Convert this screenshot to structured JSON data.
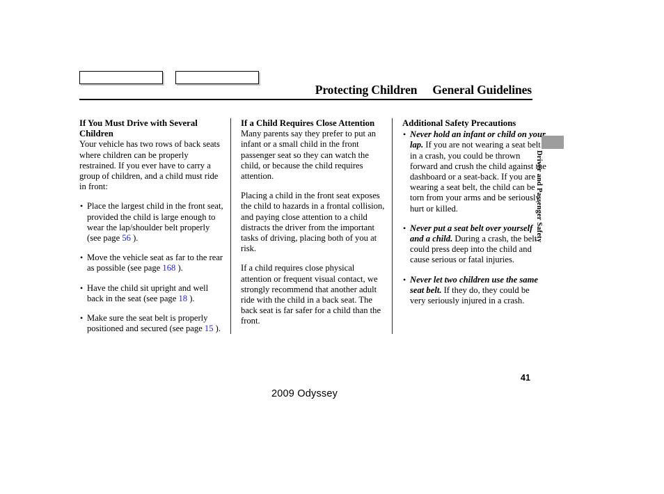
{
  "header": {
    "box1_label": "",
    "box2_label": "",
    "title_left": "Protecting Children",
    "title_right": "General Guidelines"
  },
  "side_tab": {
    "label": "Driver and Passenger Safety"
  },
  "footer": {
    "page_number": "41",
    "model": "2009  Odyssey"
  },
  "columns": {
    "col1": {
      "heading": "If You Must Drive with Several Children",
      "intro": "Your vehicle has two rows of back seats where children can be properly restrained. If you ever have to carry a group of children, and a child must ride in front:",
      "bullets": [
        {
          "text_before": "Place the largest child in the front seat, provided the child is large enough to wear the lap/shoulder belt properly (see page ",
          "page_ref": "56",
          "text_after": " )."
        },
        {
          "text_before": "Move the vehicle seat as far to the rear as possible (see page ",
          "page_ref": "168",
          "text_after": " )."
        },
        {
          "text_before": "Have the child sit upright and well back in the seat (see page ",
          "page_ref": "18",
          "text_after": " )."
        },
        {
          "text_before": "Make sure the seat belt is properly positioned and secured (see page ",
          "page_ref": "15",
          "text_after": " )."
        }
      ],
      "bullet_glyph": "•"
    },
    "col2": {
      "heading": "If a Child Requires Close Attention",
      "para1": "Many parents say they prefer to put an infant or a small child in the front passenger seat so they can watch the child, or because the child requires attention.",
      "para2": "Placing a child in the front seat exposes the child to hazards in a frontal collision, and paying close attention to a child distracts the driver from the important tasks of driving, placing both of you at risk.",
      "para3": "If a child requires close physical attention or frequent visual contact, we strongly recommend that another adult ride with the child in a back seat. The back seat is far safer for a child than the front."
    },
    "col3": {
      "heading": "Additional Safety Precautions",
      "bullet_glyph": "•",
      "bullets": [
        {
          "lead": "Never hold an infant or child on your lap.",
          "body": " If you are not wearing a seat belt in a crash, you could be thrown forward and crush the child against the dashboard or a seat-back. If you are wearing a seat belt, the child can be torn from your arms and be seriously hurt or killed."
        },
        {
          "lead": "Never put a seat belt over yourself and a child.",
          "body": " During a crash, the belt could press deep into the child and cause serious or fatal injuries."
        },
        {
          "lead": "Never let two children use the same seat belt.",
          "body": " If they do, they could be very seriously injured in a crash."
        }
      ]
    }
  },
  "colors": {
    "page_reference": "#2222dd",
    "side_tab": "#9d9d9d",
    "rule": "#000000"
  }
}
